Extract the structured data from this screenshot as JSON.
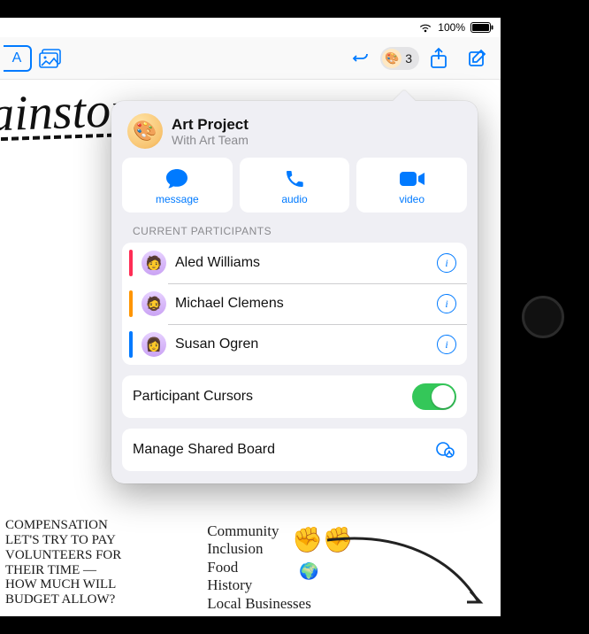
{
  "status": {
    "battery_text": "100%"
  },
  "toolbar": {
    "format_tab_label": "A",
    "collab_count": "3"
  },
  "popover": {
    "title": "Art Project",
    "subtitle": "With Art Team",
    "actions": {
      "message": "message",
      "audio": "audio",
      "video": "video"
    },
    "section_label": "Current Participants",
    "participants": [
      {
        "name": "Aled Williams",
        "cursor_color": "#ff2d55"
      },
      {
        "name": "Michael Clemens",
        "cursor_color": "#ff9500"
      },
      {
        "name": "Susan Ogren",
        "cursor_color": "#007aff"
      }
    ],
    "cursors_label": "Participant Cursors",
    "cursors_on": true,
    "manage_label": "Manage Shared Board"
  },
  "canvas": {
    "brainstorm": "ainstorm",
    "notes_block": "Compensation\nLet's try to pay\nvolunteers for\ntheir time —\nhow much will\nbudget allow?",
    "tree_block": " Community\n Inclusion\n Food\n History\n Local Businesses"
  }
}
